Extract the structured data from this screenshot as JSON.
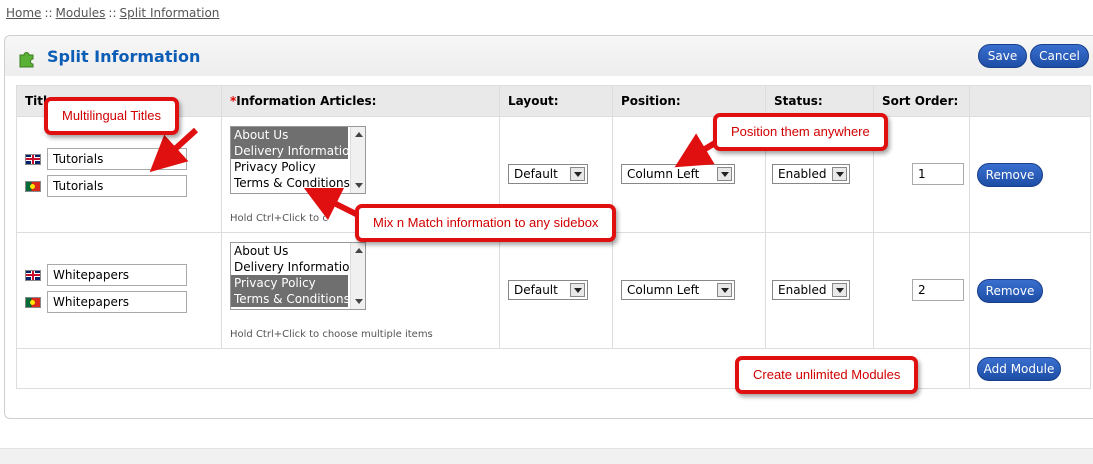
{
  "breadcrumb": {
    "home": "Home",
    "sep": "::",
    "modules": "Modules",
    "current": "Split Information"
  },
  "heading": {
    "title": "Split Information",
    "save": "Save",
    "cancel": "Cancel"
  },
  "table": {
    "col_title": "Title",
    "col_articles_req": "*",
    "col_articles": "Information Articles:",
    "col_layout": "Layout:",
    "col_position": "Position:",
    "col_status": "Status:",
    "col_sort": "Sort Order:"
  },
  "articles_options": [
    "About Us",
    "Delivery Information",
    "Privacy Policy",
    "Terms & Conditions"
  ],
  "rows": [
    {
      "title_en": "Tutorials",
      "title_pt": "Tutorials",
      "selected": [
        0,
        1
      ],
      "hint": "Hold Ctrl+Click to c",
      "layout": "Default",
      "position": "Column Left",
      "status": "Enabled",
      "sort": "1",
      "remove": "Remove"
    },
    {
      "title_en": "Whitepapers",
      "title_pt": "Whitepapers",
      "selected": [
        2,
        3
      ],
      "hint": "Hold Ctrl+Click to choose multiple items",
      "layout": "Default",
      "position": "Column Left",
      "status": "Enabled",
      "sort": "2",
      "remove": "Remove"
    }
  ],
  "footer": {
    "add_module": "Add Module"
  },
  "callouts": {
    "multilingual": "Multilingual Titles",
    "position": "Position them anywhere",
    "mix": "Mix n Match information to any sidebox",
    "unlimited": "Create unlimited Modules"
  },
  "colors": {
    "accent": "#0b5db6",
    "button": "#1d4ea6",
    "callout": "#e01010",
    "selected_option": "#6f6f6f"
  },
  "icons": {
    "module": "puzzle-piece-icon",
    "flag_en": "uk-flag-icon",
    "flag_pt": "portugal-flag-icon"
  }
}
